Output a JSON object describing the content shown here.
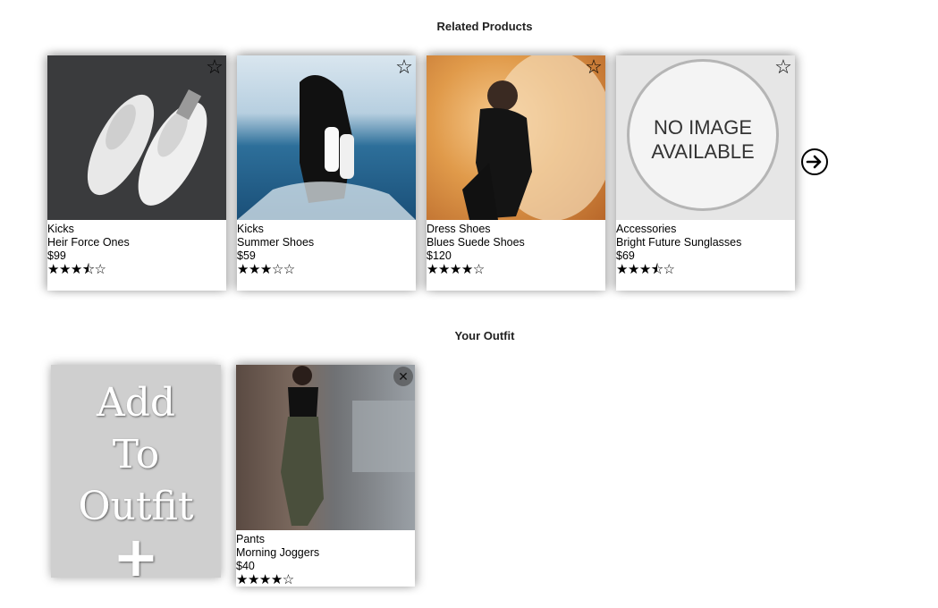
{
  "related": {
    "title": "Related Products",
    "cards": [
      {
        "category": "Kicks",
        "name": "Heir Force Ones",
        "price": "$99",
        "stars": "★★★⯪☆",
        "rating": 3.5
      },
      {
        "category": "Kicks",
        "name": "Summer Shoes",
        "price": "$59",
        "stars": "★★★☆☆",
        "rating": 3
      },
      {
        "category": "Dress Shoes",
        "name": "Blues Suede Shoes",
        "price": "$120",
        "stars": "★★★★☆",
        "rating": 4
      },
      {
        "category": "Accessories",
        "name": "Bright Future Sunglasses",
        "price": "$69",
        "stars": "★★★⯪☆",
        "rating": 3.5
      }
    ],
    "no_image_line1": "NO IMAGE",
    "no_image_line2": "AVAILABLE",
    "favorite_icon": "☆"
  },
  "outfit": {
    "title": "Your Outfit",
    "add_lines": [
      "Add",
      "To",
      "Outfit"
    ],
    "add_plus": "+",
    "remove_icon": "✕",
    "cards": [
      {
        "category": "Pants",
        "name": "Morning Joggers",
        "price": "$40",
        "stars": "★★★★☆",
        "rating": 4
      }
    ]
  },
  "colors": {
    "accent": "#000000",
    "background": "#ffffff"
  }
}
